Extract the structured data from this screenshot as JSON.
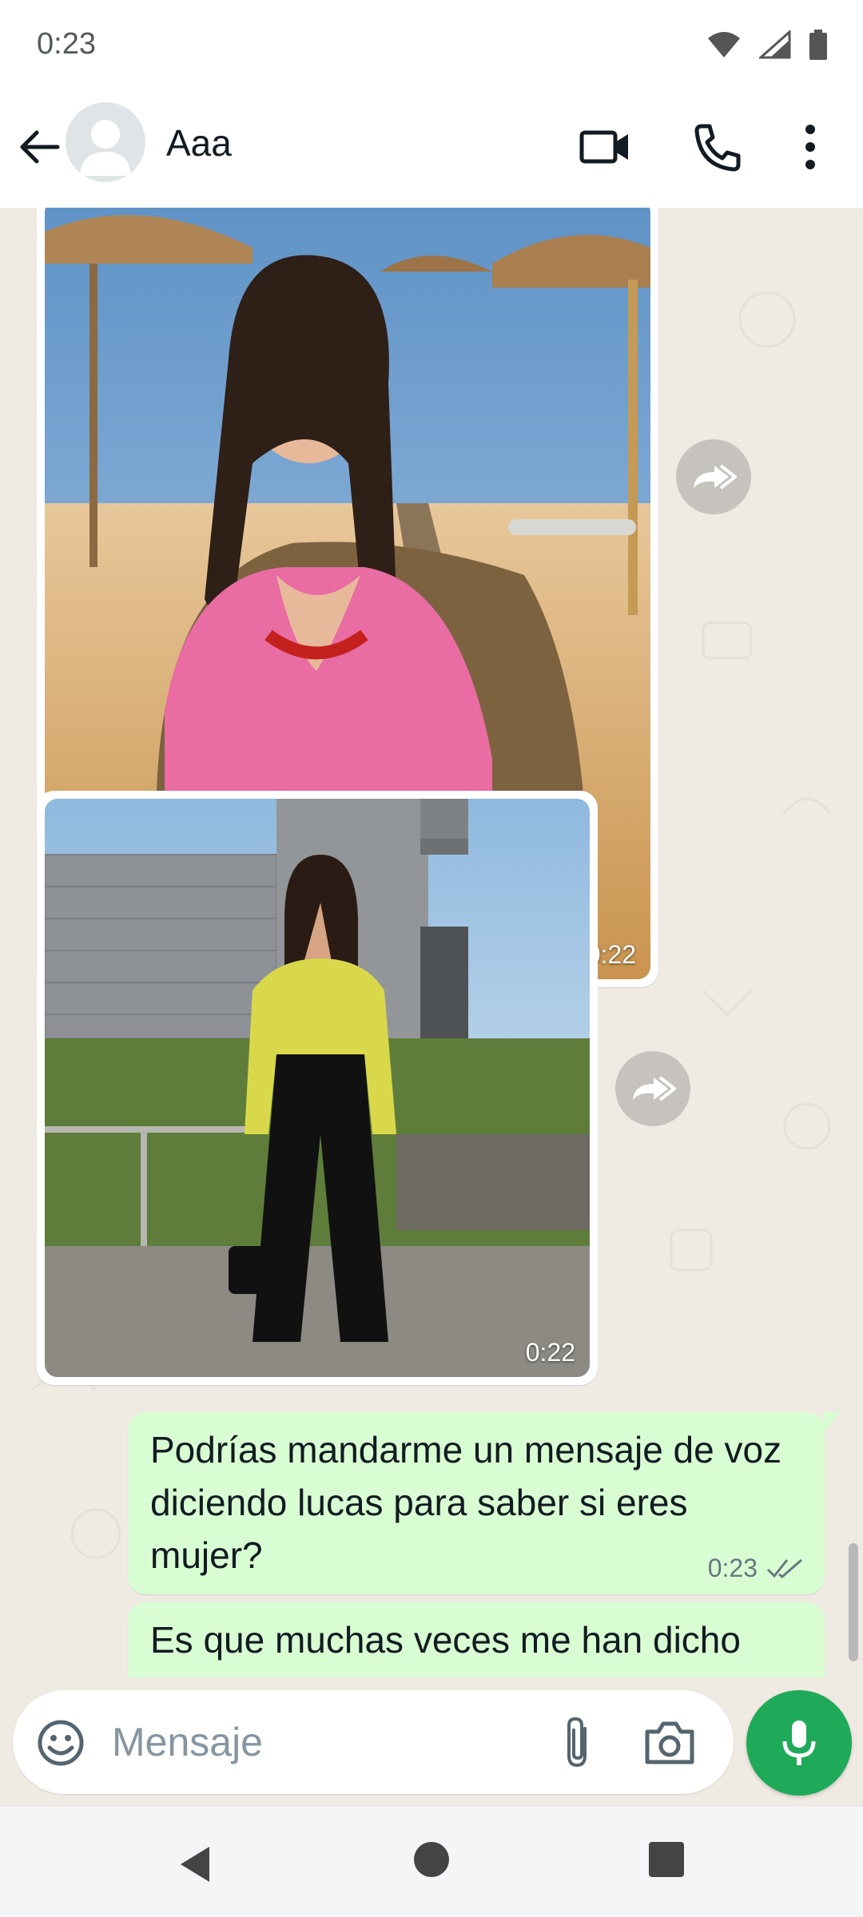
{
  "status_bar": {
    "time": "0:23",
    "icons": [
      "wifi-icon",
      "signal-icon",
      "battery-icon"
    ]
  },
  "header": {
    "contact_name": "Aaa",
    "icons": [
      "back-arrow-icon",
      "avatar-placeholder-icon",
      "video-call-icon",
      "phone-icon",
      "more-vert-icon"
    ]
  },
  "messages": [
    {
      "type": "image",
      "direction": "incoming",
      "time": "0:22",
      "content": "photo: woman in pink shirt seated in wicker chair at beach bar"
    },
    {
      "type": "image",
      "direction": "incoming",
      "time": "0:22",
      "content": "photo: woman in yellow top and black trousers near concrete building"
    },
    {
      "type": "text",
      "direction": "outgoing",
      "text": "Podrías mandarme un mensaje de voz diciendo lucas para saber si eres mujer?",
      "time": "0:23",
      "status": "read-double-check"
    },
    {
      "type": "text",
      "direction": "outgoing",
      "text": "Es que muchas veces me han dicho",
      "time": "",
      "status": ""
    }
  ],
  "composer": {
    "placeholder": "Mensaje",
    "icons": [
      "emoji-icon",
      "attach-icon",
      "camera-icon",
      "mic-icon"
    ]
  },
  "colors": {
    "chat_bg": "#efeae2",
    "outgoing_bubble": "#d9fdd3",
    "mic_button": "#1faa59",
    "tick_read": "#667781"
  }
}
